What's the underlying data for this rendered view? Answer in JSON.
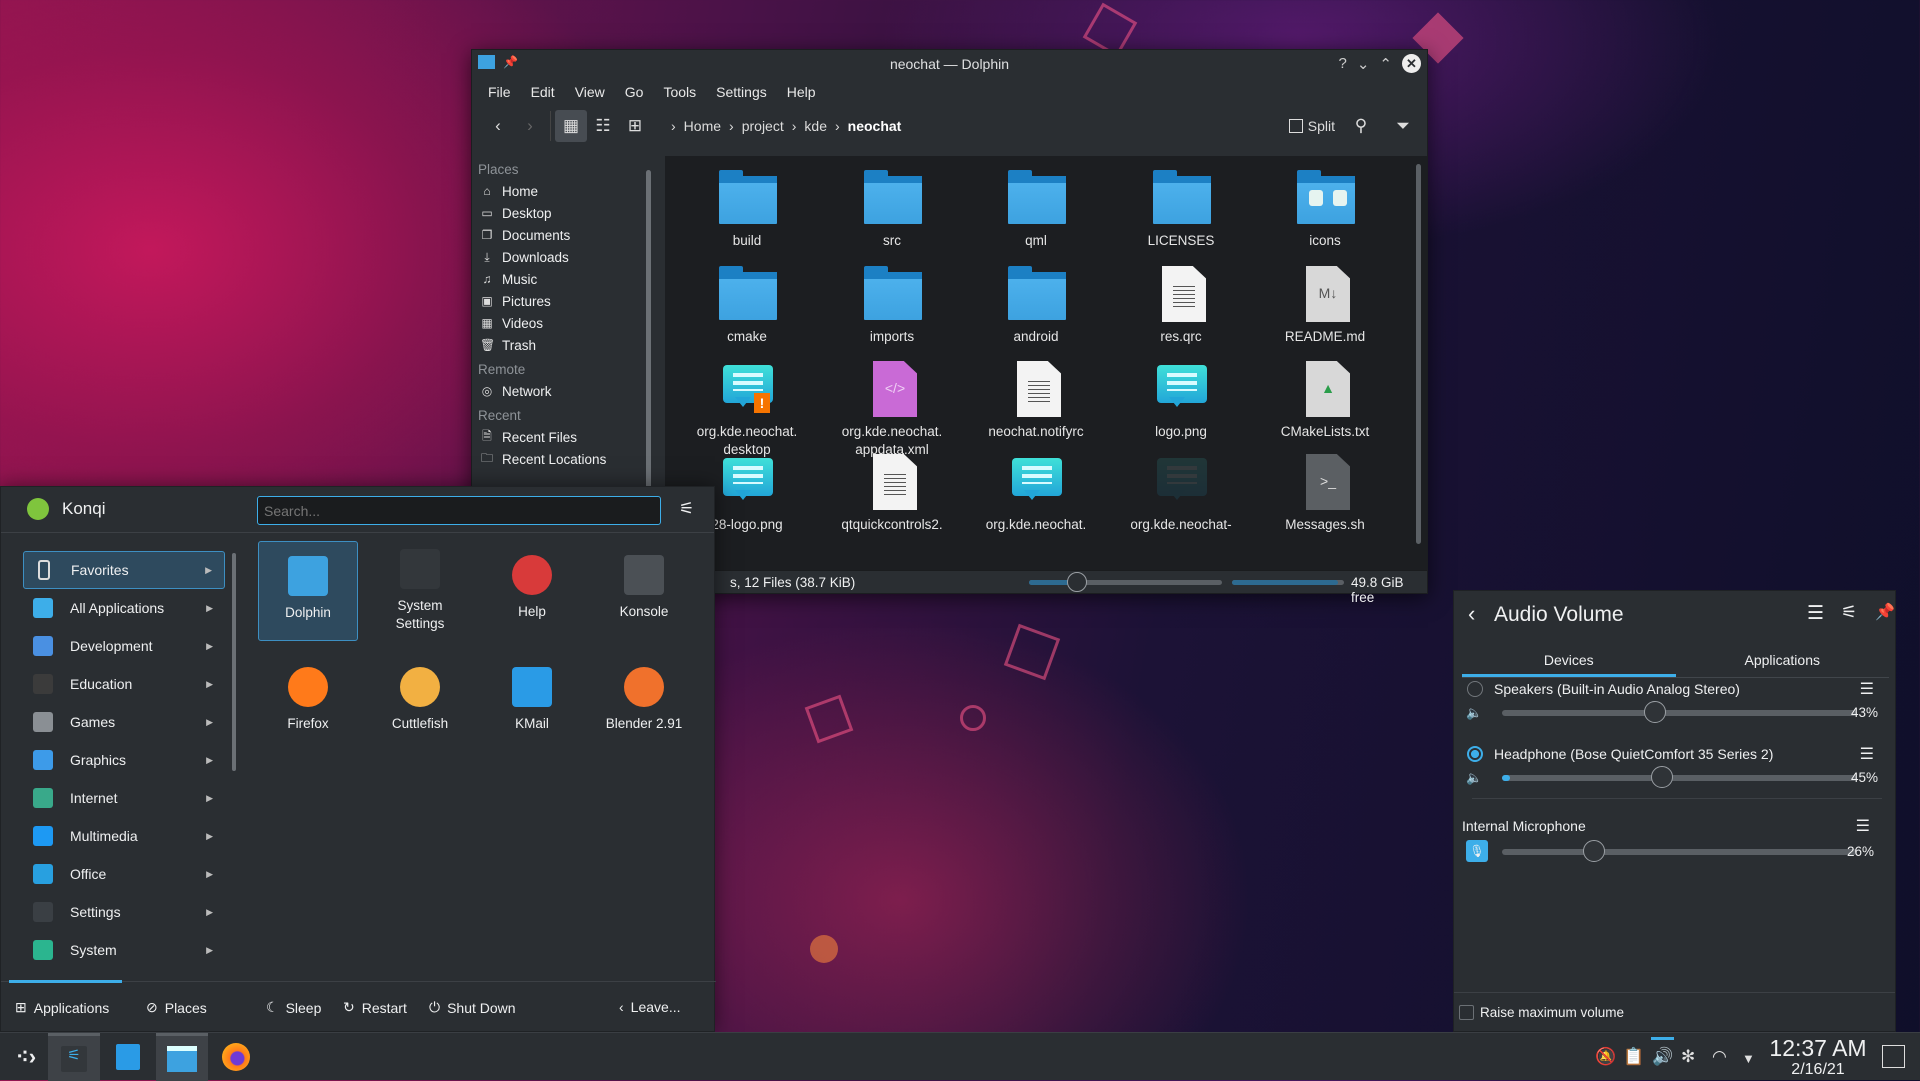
{
  "colors": {
    "accent": "#3daee9",
    "panel": "#2a2e32",
    "files_bg": "#1c1e21"
  },
  "dolphin": {
    "title": "neochat — Dolphin",
    "menu": [
      "File",
      "Edit",
      "View",
      "Go",
      "Tools",
      "Settings",
      "Help"
    ],
    "breadcrumb": [
      "Home",
      "project",
      "kde",
      "neochat"
    ],
    "split_label": "Split",
    "places": [
      {
        "type": "section",
        "label": "Places"
      },
      {
        "icon": "home-icon",
        "glyph": "⌂",
        "label": "Home"
      },
      {
        "icon": "desktop-icon",
        "glyph": "▭",
        "label": "Desktop"
      },
      {
        "icon": "documents-icon",
        "glyph": "❐",
        "label": "Documents"
      },
      {
        "icon": "downloads-icon",
        "glyph": "⤓",
        "label": "Downloads"
      },
      {
        "icon": "music-icon",
        "glyph": "♫",
        "label": "Music"
      },
      {
        "icon": "pictures-icon",
        "glyph": "▣",
        "label": "Pictures"
      },
      {
        "icon": "videos-icon",
        "glyph": "▦",
        "label": "Videos"
      },
      {
        "icon": "trash-icon",
        "glyph": "🗑",
        "label": "Trash"
      },
      {
        "type": "section",
        "label": "Remote"
      },
      {
        "icon": "network-icon",
        "glyph": "◎",
        "label": "Network"
      },
      {
        "type": "section",
        "label": "Recent"
      },
      {
        "icon": "recent-files-icon",
        "glyph": "🗎",
        "label": "Recent Files"
      },
      {
        "icon": "recent-locations-icon",
        "glyph": "🗀",
        "label": "Recent Locations"
      }
    ],
    "files": [
      {
        "name": "build",
        "kind": "folder"
      },
      {
        "name": "src",
        "kind": "folder"
      },
      {
        "name": "qml",
        "kind": "folder"
      },
      {
        "name": "LICENSES",
        "kind": "folder"
      },
      {
        "name": "icons",
        "kind": "folder-icons"
      },
      {
        "name": "cmake",
        "kind": "folder"
      },
      {
        "name": "imports",
        "kind": "folder"
      },
      {
        "name": "android",
        "kind": "folder"
      },
      {
        "name": "res.qrc",
        "kind": "text"
      },
      {
        "name": "README.md",
        "kind": "markdown"
      },
      {
        "name": "org.kde.neochat.\ndesktop",
        "kind": "chat-warning"
      },
      {
        "name": "org.kde.neochat.\nappdata.xml",
        "kind": "xml"
      },
      {
        "name": "neochat.notifyrc",
        "kind": "text"
      },
      {
        "name": "logo.png",
        "kind": "chat"
      },
      {
        "name": "CMakeLists.txt",
        "kind": "cmake"
      },
      {
        "name": "28-logo.png",
        "kind": "chat"
      },
      {
        "name": "qtquickcontrols2.",
        "kind": "text"
      },
      {
        "name": "org.kde.neochat.",
        "kind": "chat"
      },
      {
        "name": "org.kde.neochat-",
        "kind": "chat-faded"
      },
      {
        "name": "Messages.sh",
        "kind": "script"
      }
    ],
    "status_text": "s, 12 Files (38.7 KiB)",
    "zoom_level": 0.25,
    "disk_used_fraction": 0.95,
    "free_space": "49.8 GiB free"
  },
  "launcher": {
    "user": "Konqi",
    "search_placeholder": "Search...",
    "categories": [
      {
        "label": "Favorites",
        "color": "#2e4a5e",
        "icon": "bookmark-icon"
      },
      {
        "label": "All Applications",
        "color": "#3daee9",
        "icon": "grid-icon"
      },
      {
        "label": "Development",
        "color": "#4a90e2",
        "icon": "development-icon"
      },
      {
        "label": "Education",
        "color": "#3b3b3b",
        "icon": "education-icon"
      },
      {
        "label": "Games",
        "color": "#8a8f94",
        "icon": "games-icon"
      },
      {
        "label": "Graphics",
        "color": "#3d9be9",
        "icon": "graphics-icon"
      },
      {
        "label": "Internet",
        "color": "#39a98a",
        "icon": "internet-icon"
      },
      {
        "label": "Multimedia",
        "color": "#1d99f3",
        "icon": "multimedia-icon"
      },
      {
        "label": "Office",
        "color": "#28a0e0",
        "icon": "office-icon"
      },
      {
        "label": "Settings",
        "color": "#3a3f44",
        "icon": "settings-icon"
      },
      {
        "label": "System",
        "color": "#2bb58f",
        "icon": "system-icon"
      }
    ],
    "favorites": [
      {
        "label": "Dolphin",
        "color": "#3da2e0",
        "icon": "dolphin-icon"
      },
      {
        "label": "System\nSettings",
        "color": "#33373b",
        "icon": "system-settings-icon"
      },
      {
        "label": "Help",
        "color": "#d83a3a",
        "icon": "help-icon"
      },
      {
        "label": "Konsole",
        "color": "#4b5055",
        "icon": "konsole-icon"
      },
      {
        "label": "Firefox",
        "color": "#ff7a1a",
        "icon": "firefox-icon"
      },
      {
        "label": "Cuttlefish",
        "color": "#f2b042",
        "icon": "cuttlefish-icon"
      },
      {
        "label": "KMail",
        "color": "#2a9be6",
        "icon": "kmail-icon"
      },
      {
        "label": "Blender 2.91",
        "color": "#f0712c",
        "icon": "blender-icon"
      }
    ],
    "footer": {
      "applications": "Applications",
      "places": "Places",
      "sleep": "Sleep",
      "restart": "Restart",
      "shutdown": "Shut Down",
      "leave": "Leave..."
    }
  },
  "audio": {
    "title": "Audio Volume",
    "tabs": [
      "Devices",
      "Applications"
    ],
    "devices": [
      {
        "label": "Speakers (Built-in Audio Analog Stereo)",
        "volume": 43,
        "percent": "43%",
        "default": false
      },
      {
        "label": "Headphone (Bose QuietComfort 35 Series 2)",
        "volume": 45,
        "percent": "45%",
        "default": true
      }
    ],
    "mic": {
      "label": "Internal Microphone",
      "volume": 26,
      "percent": "26%",
      "muted": true
    },
    "raise_max": "Raise maximum volume"
  },
  "taskbar": {
    "clock_time": "12:37 AM",
    "clock_date": "2/16/21"
  }
}
